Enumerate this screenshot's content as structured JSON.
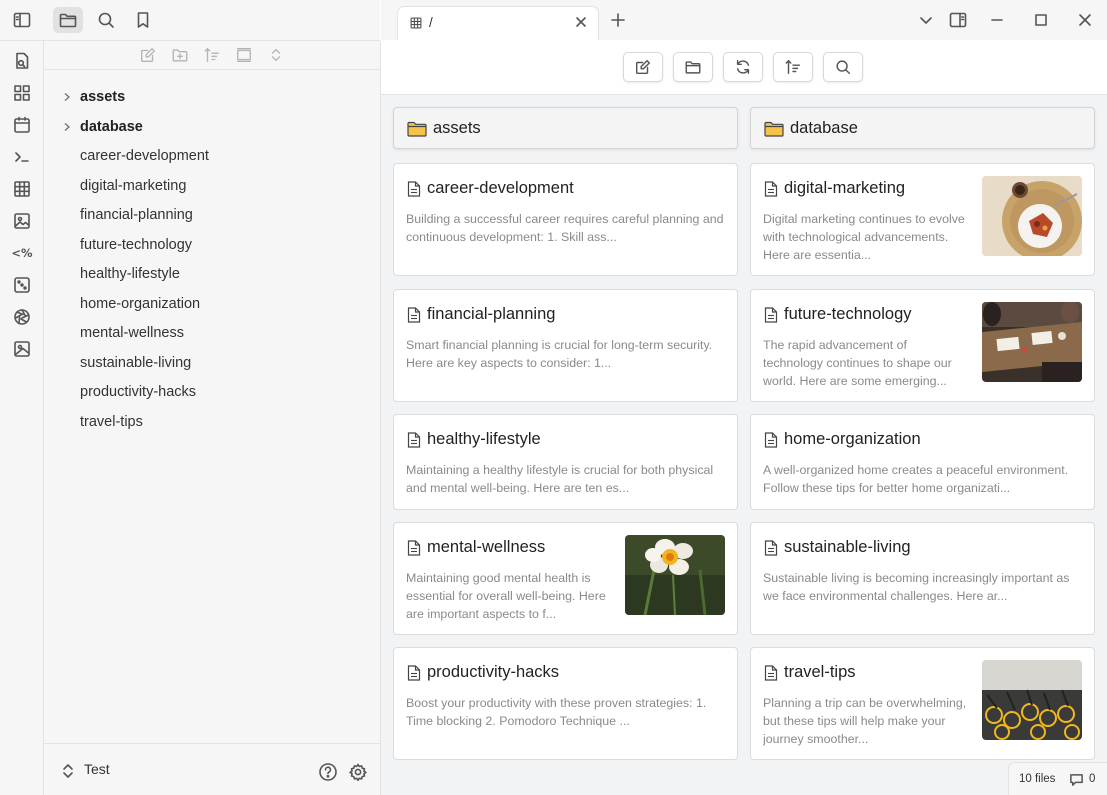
{
  "topbar": {
    "icons": [
      "sidebar-toggle-icon",
      "folder-icon",
      "search-icon",
      "bookmark-icon"
    ]
  },
  "ribbon": {
    "icons": [
      "open-quick-switcher-icon",
      "layout-grid-icon",
      "calendar-icon",
      "terminal-icon",
      "table-icon",
      "image-gallery-icon",
      "percent-template-icon",
      "random-dice-icon",
      "aperture-icon",
      "image-icon"
    ],
    "templater_glyph": "<%"
  },
  "nav_actions": [
    "new-note-icon",
    "new-folder-icon",
    "sort-icon",
    "collapse-icon",
    "expand-icon"
  ],
  "file_tree": {
    "folders": [
      "assets",
      "database"
    ],
    "files": [
      "career-development",
      "digital-marketing",
      "financial-planning",
      "future-technology",
      "healthy-lifestyle",
      "home-organization",
      "mental-wellness",
      "sustainable-living",
      "productivity-hacks",
      "travel-tips"
    ]
  },
  "vault": {
    "name": "Test"
  },
  "tab": {
    "title": "/"
  },
  "toolbar_buttons": [
    "new-note-icon",
    "open-folder-icon",
    "refresh-icon",
    "sort-icon",
    "search-icon"
  ],
  "folders": [
    {
      "name": "assets"
    },
    {
      "name": "database"
    }
  ],
  "notes": [
    {
      "title": "career-development",
      "preview": "Building a successful career requires careful planning and continuous development: 1. Skill ass...",
      "image": ""
    },
    {
      "title": "digital-marketing",
      "preview": "Digital marketing continues to evolve with technological advancements. Here are essentia...",
      "image": "food-plate"
    },
    {
      "title": "financial-planning",
      "preview": "Smart financial planning is crucial for long-term security. Here are key aspects to consider: 1...",
      "image": ""
    },
    {
      "title": "future-technology",
      "preview": "The rapid advancement of technology continues to shape our world. Here are some emerging...",
      "image": "meeting-table"
    },
    {
      "title": "healthy-lifestyle",
      "preview": "Maintaining a healthy lifestyle is crucial for both physical and mental well-being. Here are ten es...",
      "image": ""
    },
    {
      "title": "home-organization",
      "preview": "A well-organized home creates a peaceful environment. Follow these tips for better home organizati...",
      "image": ""
    },
    {
      "title": "mental-wellness",
      "preview": "Maintaining good mental health is essential for overall well-being. Here are important aspects to f...",
      "image": "daffodil"
    },
    {
      "title": "sustainable-living",
      "preview": "Sustainable living is becoming increasingly important as we face environmental challenges. Here ar...",
      "image": ""
    },
    {
      "title": "productivity-hacks",
      "preview": "Boost your productivity with these proven strategies: 1. Time blocking 2. Pomodoro Technique ...",
      "image": ""
    },
    {
      "title": "travel-tips",
      "preview": "Planning a trip can be overwhelming, but these tips will help make your journey smoother...",
      "image": "bicycles"
    }
  ],
  "status": {
    "files": "10 files",
    "comments": "0"
  },
  "colors": {
    "folder_fill": "#f5c24b",
    "accent_bg": "#f2f3f5",
    "card_border": "#dcdcdc"
  }
}
